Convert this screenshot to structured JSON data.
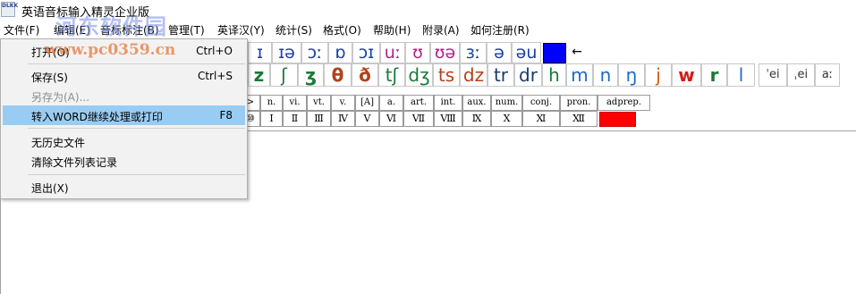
{
  "title": "英语音标输入精灵企业版",
  "app_icon_text": "DLKK",
  "watermark": {
    "line1": "河东软件园",
    "line2": "www.pc0359.cn"
  },
  "menubar": [
    "文件(F)",
    "编辑(E)",
    "音标标注(B)",
    "管理(T)",
    "英译汉(Y)",
    "统计(S)",
    "格式(O)",
    "帮助(H)",
    "附录(A)",
    "如何注册(R)"
  ],
  "file_menu": {
    "items": [
      {
        "label": "打开(O)",
        "shortcut": "Ctrl+O"
      },
      {
        "label": "保存(S)",
        "shortcut": "Ctrl+S"
      },
      {
        "label": "另存为(A)...",
        "shortcut": ""
      },
      {
        "label": "转入WORD继续处理或打印",
        "shortcut": "F8"
      },
      {
        "label": "无历史文件",
        "shortcut": ""
      },
      {
        "label": "清除文件列表记录",
        "shortcut": ""
      },
      {
        "label": "退出(X)",
        "shortcut": ""
      }
    ]
  },
  "ipa_row1": [
    "ɪ",
    "ɪə",
    "ɔː",
    "ɒ",
    "ɔɪ",
    "uː",
    "ʊ",
    "ʊə",
    "ɜː",
    "ə",
    "əu",
    "",
    "←"
  ],
  "ipa_row2": [
    "z",
    "ʃ",
    "ʒ",
    "θ",
    "ð",
    "tʃ",
    "dʒ",
    "ts",
    "dz",
    "tr",
    "dr",
    "h",
    "m",
    "n",
    "ŋ",
    "j",
    "w",
    "r",
    "l",
    "ˈei",
    "ˌei",
    "aː"
  ],
  "pos_row": [
    ">",
    "n.",
    "vi.",
    "vt.",
    "v.",
    "[A]",
    "a.",
    "art.",
    "int.",
    "aux.",
    "num.",
    "conj.",
    "pron.",
    "adprep."
  ],
  "roman_row": [
    "Ⅰ",
    "Ⅱ",
    "Ⅲ",
    "Ⅳ",
    "Ⅴ",
    "Ⅵ",
    "Ⅶ",
    "Ⅷ",
    "Ⅸ",
    "Ⅹ",
    "Ⅺ",
    "Ⅻ"
  ],
  "roman_first_partial": "⑩",
  "colors": {
    "highlight": "#99ccf2",
    "blue_swatch": "#0000ff",
    "red_swatch": "#ff0000",
    "watermark_blue": "#7f8fe6",
    "watermark_orange": "#e6783c"
  }
}
